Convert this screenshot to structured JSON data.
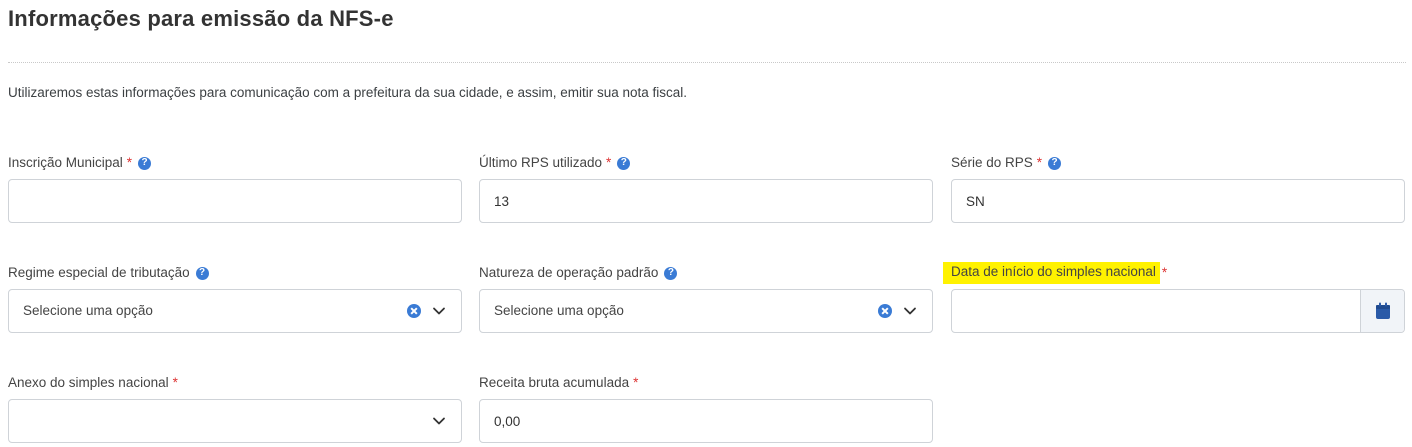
{
  "page": {
    "title": "Informações para emissão da NFS-e",
    "intro": "Utilizaremos estas informações para comunicação com a prefeitura da sua cidade, e assim, emitir sua nota fiscal."
  },
  "fields": {
    "inscricao": {
      "label": "Inscrição Municipal",
      "required": "*",
      "value": ""
    },
    "ultimo_rps": {
      "label": "Último RPS utilizado",
      "required": "*",
      "value": "13"
    },
    "serie_rps": {
      "label": "Série do RPS",
      "required": "*",
      "value": "SN"
    },
    "regime": {
      "label": "Regime especial de tributação",
      "selected": "Selecione uma opção"
    },
    "natureza": {
      "label": "Natureza de operação padrão",
      "selected": "Selecione uma opção"
    },
    "data_inicio": {
      "label": "Data de início do simples nacional",
      "required": "*",
      "value": ""
    },
    "anexo": {
      "label": "Anexo do simples nacional",
      "required": "*",
      "selected": ""
    },
    "receita": {
      "label": "Receita bruta acumulada",
      "required": "*",
      "value": "0,00"
    }
  },
  "icons": {
    "help": "question-circle-icon",
    "clear": "clear-circle-icon",
    "chevron": "chevron-down-icon",
    "calendar": "calendar-icon"
  },
  "colors": {
    "accent": "#3a7bd5",
    "required": "#dd3333",
    "highlight": "#fff200",
    "calendar_icon": "#2a5aa8"
  }
}
